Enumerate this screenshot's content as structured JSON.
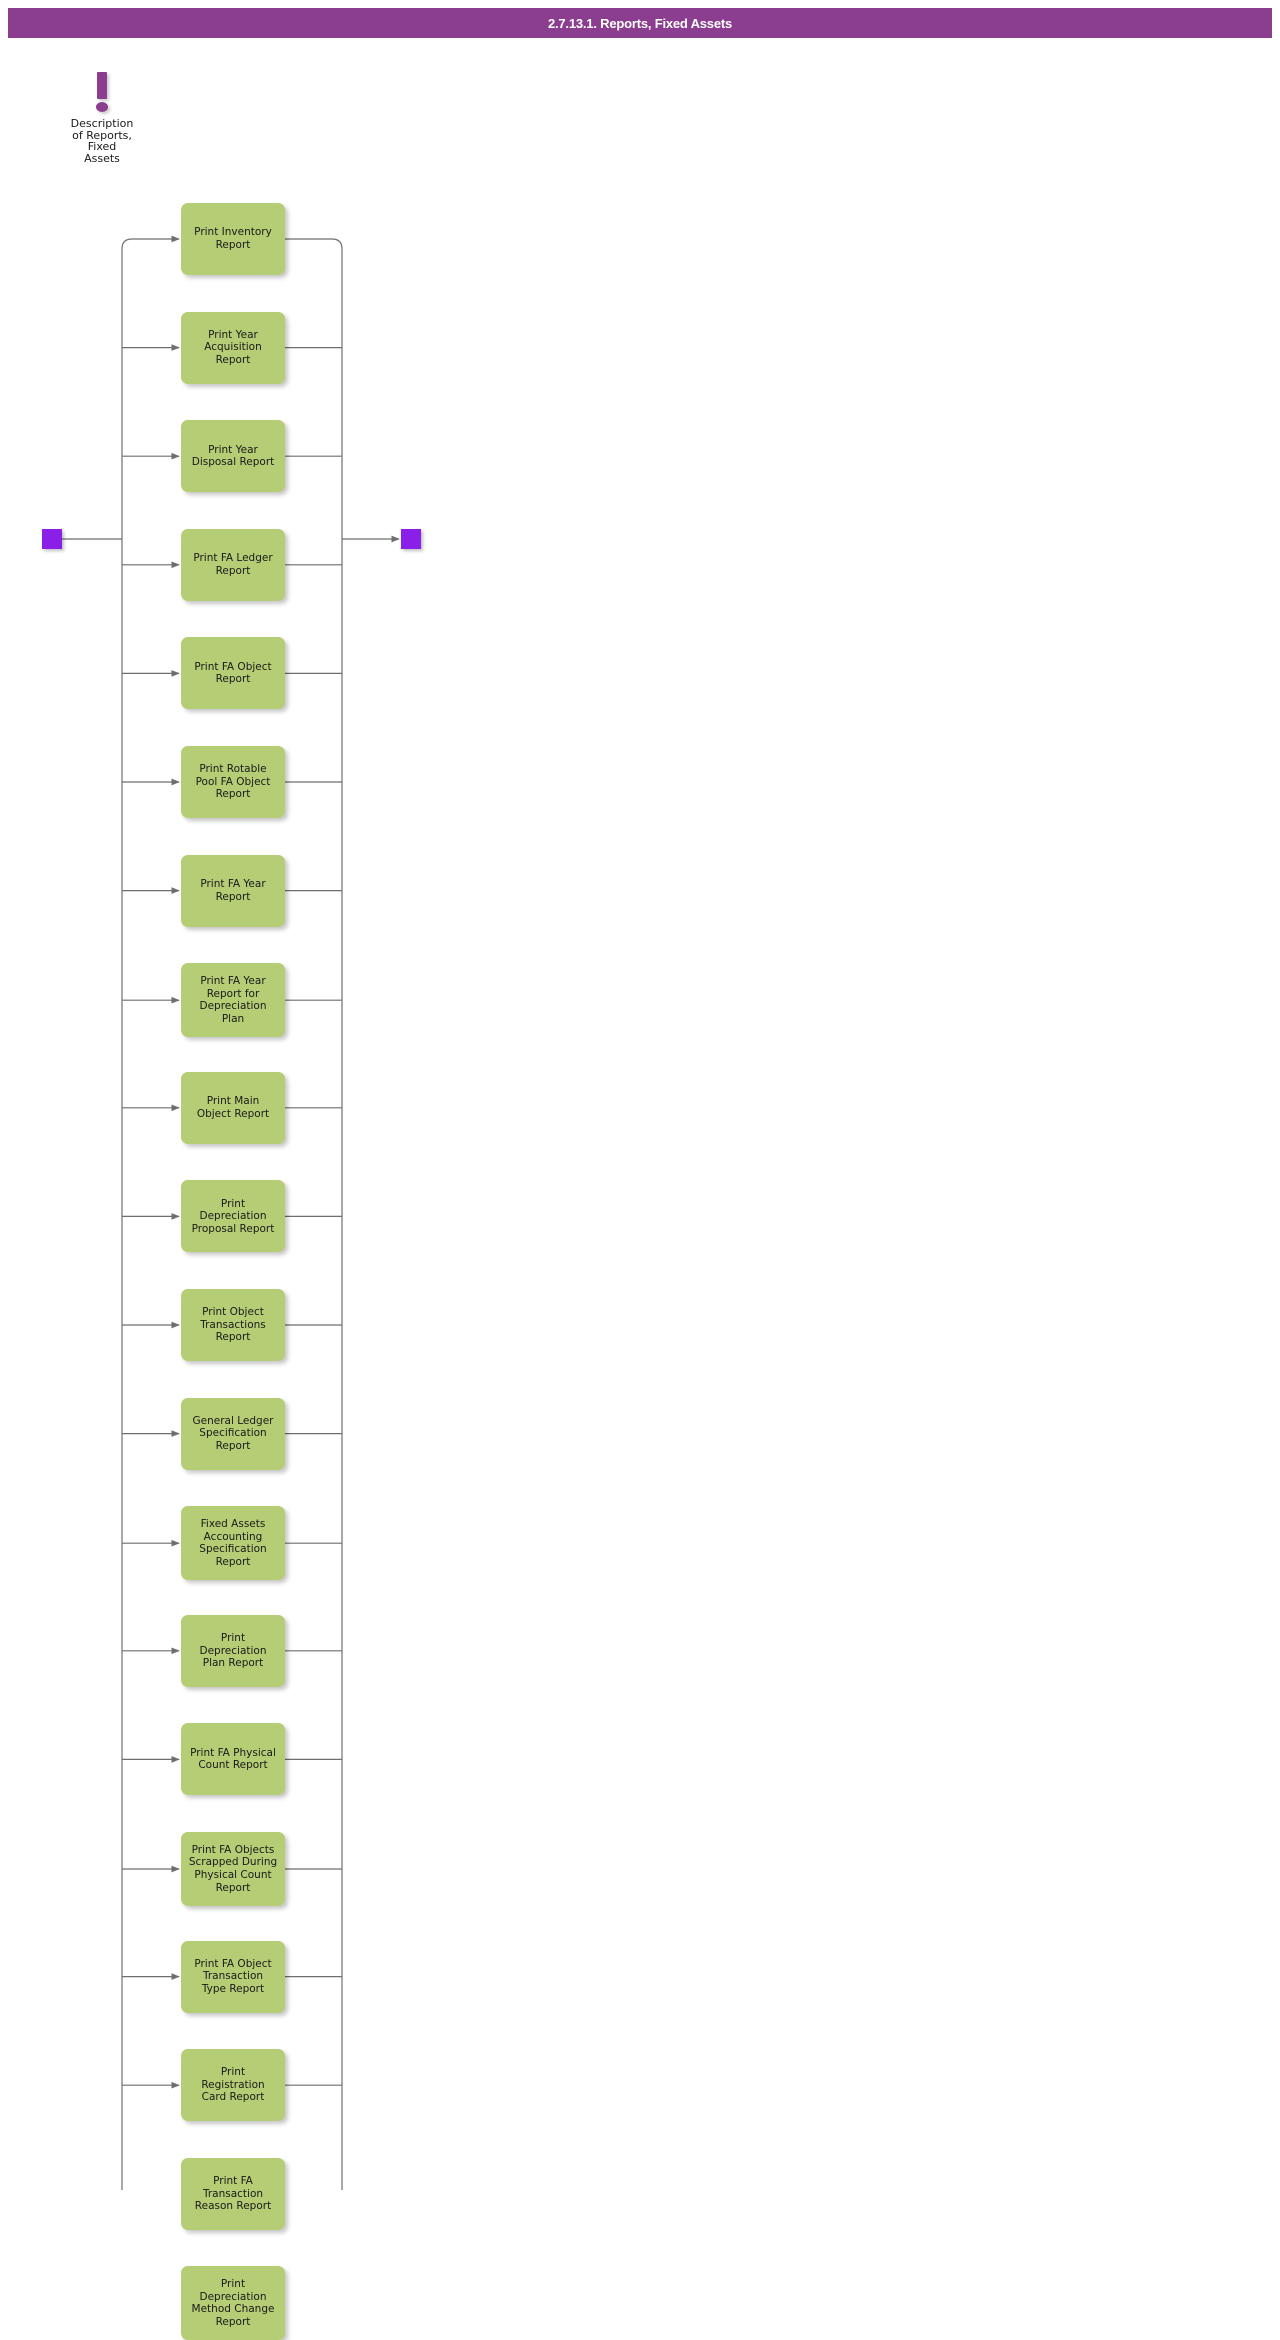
{
  "header": {
    "title": "2.7.13.1. Reports, Fixed Assets",
    "bar_color": "#8B3E8F"
  },
  "annotation": {
    "icon": "exclamation-mark-icon",
    "label": "Description\nof Reports,\nFixed\nAssets",
    "color": "#8B3E8F"
  },
  "flow": {
    "start_node_label": "",
    "end_node_label": "",
    "node_color": "#8A1FE8",
    "process_color": "#B5CE75",
    "connector_color": "#6E6E6E",
    "steps": [
      {
        "label": "Print Inventory\nReport"
      },
      {
        "label": "Print Year\nAcquisition\nReport"
      },
      {
        "label": "Print Year\nDisposal Report"
      },
      {
        "label": "Print FA Ledger\nReport"
      },
      {
        "label": "Print FA Object\nReport"
      },
      {
        "label": "Print Rotable\nPool FA Object\nReport"
      },
      {
        "label": "Print FA Year\nReport"
      },
      {
        "label": "Print FA Year\nReport for\nDepreciation\nPlan"
      },
      {
        "label": "Print Main\nObject Report"
      },
      {
        "label": "Print\nDepreciation\nProposal Report"
      },
      {
        "label": "Print Object\nTransactions\nReport"
      },
      {
        "label": "General Ledger\nSpecification\nReport"
      },
      {
        "label": "Fixed Assets\nAccounting\nSpecification\nReport"
      },
      {
        "label": "Print\nDepreciation\nPlan Report"
      },
      {
        "label": "Print FA Physical\nCount Report"
      },
      {
        "label": "Print FA Objects\nScrapped During\nPhysical Count\nReport"
      },
      {
        "label": "Print FA Object\nTransaction\nType Report"
      },
      {
        "label": "Print\nRegistration\nCard Report"
      },
      {
        "label": "Print FA\nTransaction\nReason Report"
      },
      {
        "label": "Print\nDepreciation\nMethod Change\nReport"
      }
    ]
  }
}
